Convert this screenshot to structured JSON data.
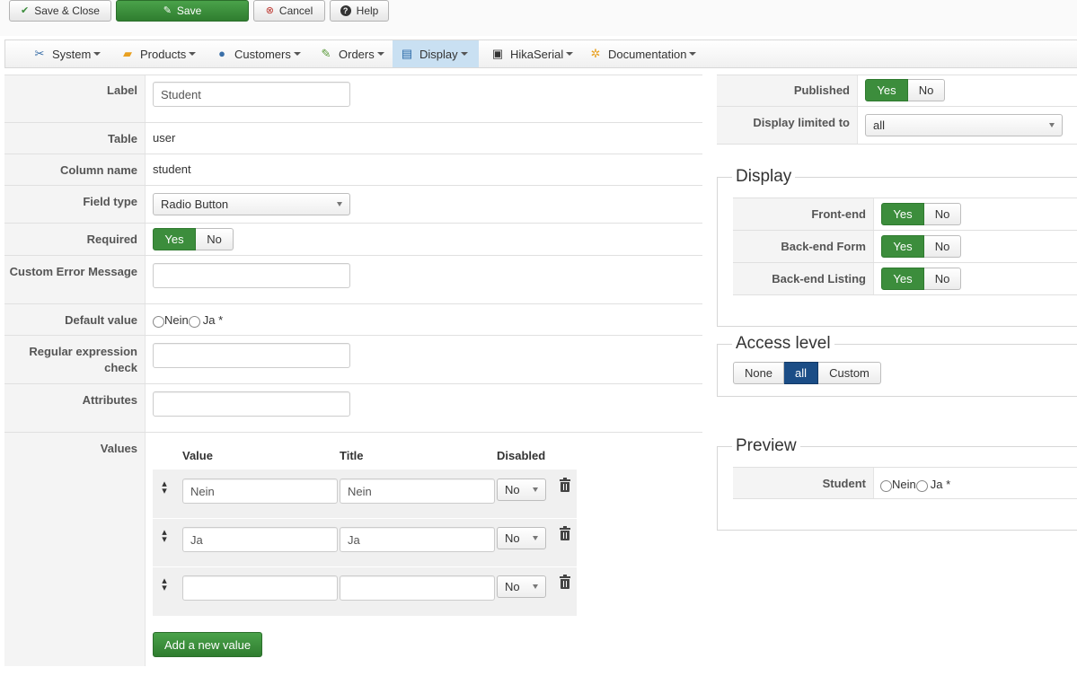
{
  "toolbar": {
    "save_close": "Save & Close",
    "save": "Save",
    "cancel": "Cancel",
    "help": "Help"
  },
  "menu": {
    "items": [
      {
        "label": "System",
        "icon": "tools-icon"
      },
      {
        "label": "Products",
        "icon": "box-icon"
      },
      {
        "label": "Customers",
        "icon": "users-icon"
      },
      {
        "label": "Orders",
        "icon": "orders-icon"
      },
      {
        "label": "Display",
        "icon": "display-icon"
      },
      {
        "label": "HikaSerial",
        "icon": "serial-icon"
      },
      {
        "label": "Documentation",
        "icon": "documentation-icon"
      }
    ],
    "active": "Display"
  },
  "form": {
    "label_label": "Label",
    "label_value": "Student",
    "table_label": "Table",
    "table_value": "user",
    "column_label": "Column name",
    "column_value": "student",
    "fieldtype_label": "Field type",
    "fieldtype_value": "Radio Button",
    "required_label": "Required",
    "required_yes": "Yes",
    "required_no": "No",
    "custom_error_label": "Custom Error Message",
    "custom_error_value": "",
    "default_label": "Default value",
    "default_opt1": "Nein",
    "default_opt2": "Ja *",
    "regex_label": "Regular expression check",
    "regex_value": "",
    "attributes_label": "Attributes",
    "attributes_value": "",
    "values_label": "Values"
  },
  "values_table": {
    "headers": {
      "value": "Value",
      "title": "Title",
      "disabled": "Disabled"
    },
    "rows": [
      {
        "value": "Nein",
        "title": "Nein",
        "disabled": "No"
      },
      {
        "value": "Ja",
        "title": "Ja",
        "disabled": "No"
      },
      {
        "value": "",
        "title": "",
        "disabled": "No"
      }
    ],
    "add_button": "Add a new value"
  },
  "right": {
    "published_label": "Published",
    "published_yes": "Yes",
    "published_no": "No",
    "limited_label": "Display limited to",
    "limited_value": "all",
    "display_legend": "Display",
    "frontend_label": "Front-end",
    "backform_label": "Back-end Form",
    "backlist_label": "Back-end Listing",
    "yes": "Yes",
    "no": "No",
    "access_legend": "Access level",
    "access_none": "None",
    "access_all": "all",
    "access_custom": "Custom",
    "preview_legend": "Preview",
    "preview_label": "Student",
    "preview_opt1": "Nein",
    "preview_opt2": "Ja *"
  },
  "colors": {
    "green": "#3c8d3c",
    "blue_active": "#1b4d86",
    "menu_active": "#c9e0f2"
  }
}
